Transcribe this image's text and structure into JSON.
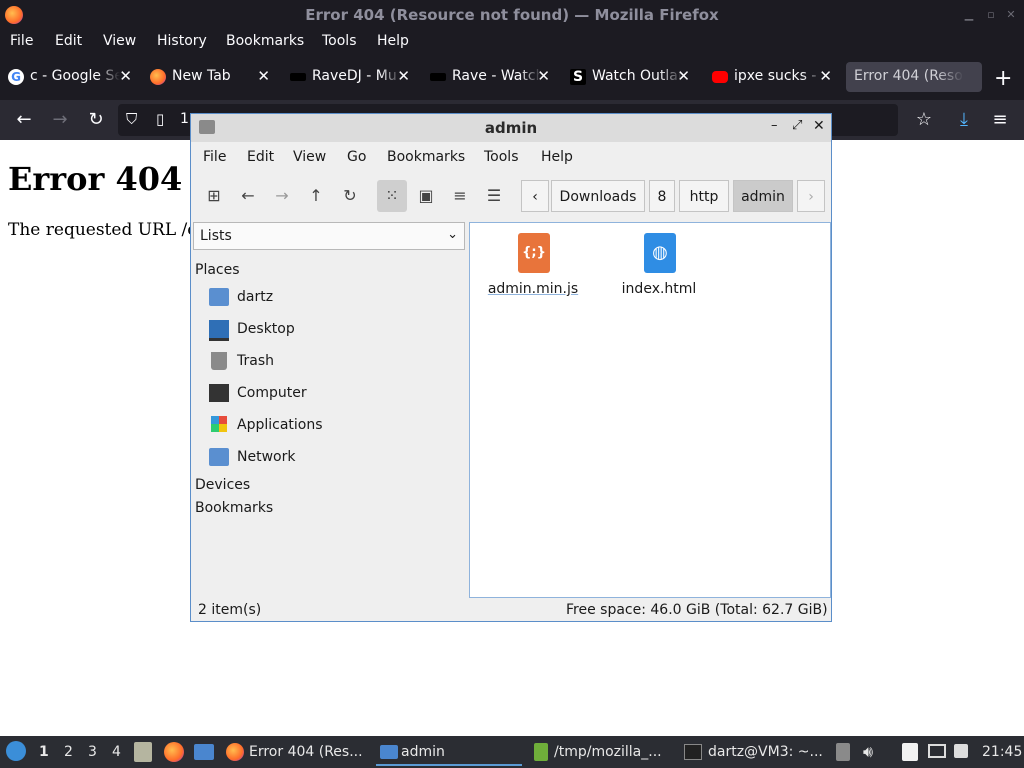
{
  "firefox": {
    "window_title": "Error 404 (Resource not found) — Mozilla Firefox",
    "menu": [
      "File",
      "Edit",
      "View",
      "History",
      "Bookmarks",
      "Tools",
      "Help"
    ],
    "tabs": [
      {
        "label": "c - Google Se",
        "icon": "google-icon",
        "active": false
      },
      {
        "label": "New Tab",
        "icon": "firefox-icon",
        "active": false
      },
      {
        "label": "RaveDJ - Mu",
        "icon": "ravedj-icon",
        "active": false
      },
      {
        "label": "Rave - Watch",
        "icon": "rave-icon",
        "active": false
      },
      {
        "label": "Watch Outlan",
        "icon": "s-icon",
        "active": false
      },
      {
        "label": "ipxe sucks -",
        "icon": "youtube-icon",
        "active": false
      },
      {
        "label": "Error 404 (Reso",
        "icon": "",
        "active": true
      }
    ],
    "url_fragment": "1"
  },
  "page": {
    "heading": "Error 404",
    "body": "The requested URL /co"
  },
  "file_manager": {
    "title": "admin",
    "menu": [
      "File",
      "Edit",
      "View",
      "Go",
      "Bookmarks",
      "Tools",
      "Help"
    ],
    "breadcrumbs": [
      "Downloads",
      "8",
      "http",
      "admin"
    ],
    "side_pane_mode": "Lists",
    "sections": {
      "places": "Places",
      "devices": "Devices",
      "bookmarks": "Bookmarks"
    },
    "places": [
      {
        "label": "dartz",
        "icon": "home-folder-icon"
      },
      {
        "label": "Desktop",
        "icon": "desktop-icon"
      },
      {
        "label": "Trash",
        "icon": "trash-icon"
      },
      {
        "label": "Computer",
        "icon": "computer-icon"
      },
      {
        "label": "Applications",
        "icon": "applications-icon"
      },
      {
        "label": "Network",
        "icon": "network-icon"
      }
    ],
    "files": [
      {
        "name": "admin.min.js",
        "icon": "javascript-file-icon"
      },
      {
        "name": "index.html",
        "icon": "html-file-icon"
      }
    ],
    "status_left": "2 item(s)",
    "status_right": "Free space: 46.0 GiB (Total: 62.7 GiB)"
  },
  "taskbar": {
    "workspaces": [
      "1",
      "2",
      "3",
      "4"
    ],
    "tasks": [
      "Error 404 (Res...",
      "admin",
      "/tmp/mozilla_...",
      "dartz@VM3: ~..."
    ],
    "clock": "21:45"
  },
  "colors": {
    "accent": "#5b8ec9",
    "ff_dark": "#1c1b22",
    "taskbar": "#2b2d33"
  }
}
